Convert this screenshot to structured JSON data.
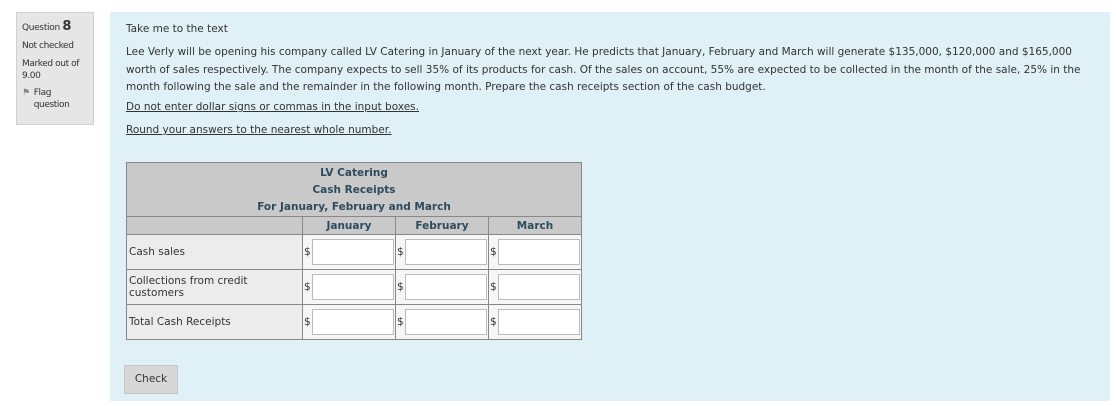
{
  "info": {
    "question_label": "Question",
    "question_number": "8",
    "state": "Not checked",
    "grade": "Marked out of 9.00",
    "flag_label": "Flag question",
    "flag_icon": "flag-icon"
  },
  "content": {
    "take_me_link": "Take me to the text",
    "question_text": "Lee Verly will be opening his company called LV Catering in January of the next year. He predicts that January, February and March will generate $135,000, $120,000 and $165,000 worth of sales respectively. The company expects to sell 35% of its products for cash. Of the sales on account, 55% are expected to be collected in the month of the sale, 25% in the month following the sale and the remainder in the following month. Prepare the cash receipts section of the cash budget.",
    "note_1": "Do not enter dollar signs or commas in the input boxes.",
    "note_2": "Round your answers to the nearest whole number."
  },
  "table": {
    "company": "LV Catering",
    "title": "Cash Receipts",
    "period": "For January, February and March",
    "columns": [
      "January",
      "February",
      "March"
    ],
    "currency_symbol": "$",
    "rows": [
      {
        "label": "Cash sales",
        "values": [
          "",
          "",
          ""
        ]
      },
      {
        "label": "Collections from credit customers",
        "values": [
          "",
          "",
          ""
        ]
      },
      {
        "label": "Total Cash Receipts",
        "values": [
          "",
          "",
          ""
        ]
      }
    ]
  },
  "check_button": "Check"
}
